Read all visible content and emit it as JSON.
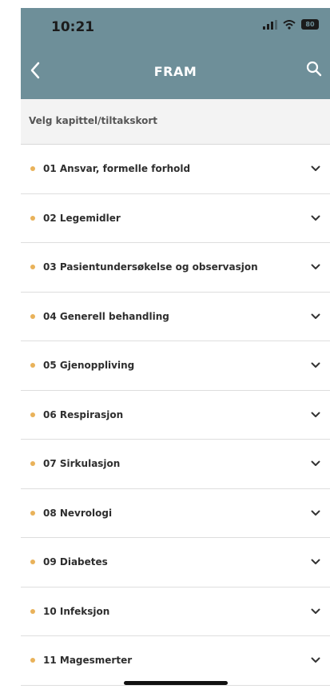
{
  "status_bar": {
    "time": "10:21",
    "battery_label": "80"
  },
  "nav": {
    "title": "FRAM",
    "back_icon": "chevron-left-icon",
    "search_icon": "search-icon"
  },
  "section": {
    "label": "Velg kapittel/tiltakskort"
  },
  "chapters": [
    {
      "label": "01 Ansvar, formelle forhold"
    },
    {
      "label": "02 Legemidler"
    },
    {
      "label": "03 Pasientundersøkelse og observasjon"
    },
    {
      "label": "04 Generell behandling"
    },
    {
      "label": "05 Gjenoppliving"
    },
    {
      "label": "06 Respirasjon"
    },
    {
      "label": "07 Sirkulasjon"
    },
    {
      "label": "08 Nevrologi"
    },
    {
      "label": "09 Diabetes"
    },
    {
      "label": "10 Infeksjon"
    },
    {
      "label": "11 Magesmerter"
    }
  ],
  "colors": {
    "header_bg": "#6e8f99",
    "bullet": "#e9b25a",
    "section_bg": "#f3f3f3"
  }
}
